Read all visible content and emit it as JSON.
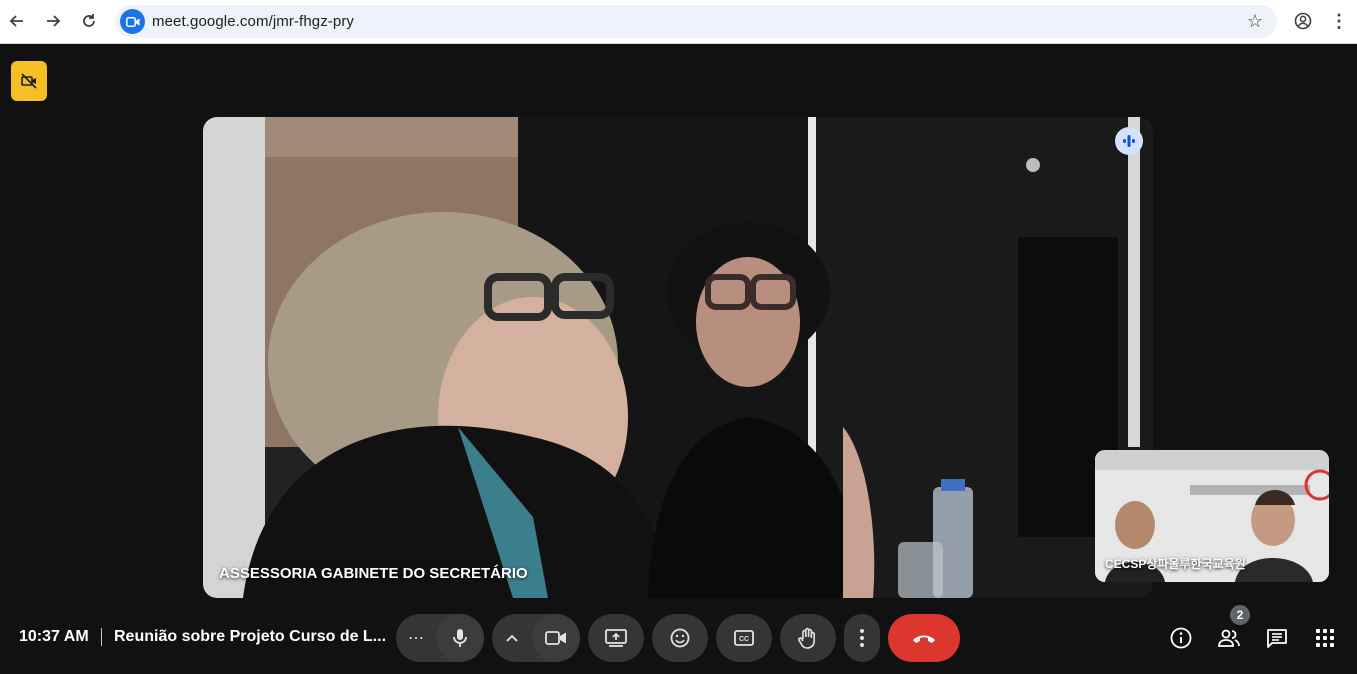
{
  "browser": {
    "url": "meet.google.com/jmr-fhgz-pry",
    "icons": [
      "back-arrow-icon",
      "forward-arrow-icon",
      "reload-icon",
      "meet-camera-icon",
      "star-icon",
      "profile-icon",
      "more-vert-icon"
    ]
  },
  "meet": {
    "main_participant": "ASSESSORIA GABINETE DO SECRETÁRIO",
    "self_participant": "CECSP상파울루한국교육원",
    "time": "10:37 AM",
    "meeting_title": "Reunião sobre Projeto Curso de L...",
    "participants_count": "2",
    "colors": {
      "background": "#111111",
      "control": "#333537",
      "hangup": "#dc362e",
      "flag": "#f6bf26",
      "accent": "#1a73e8"
    }
  }
}
